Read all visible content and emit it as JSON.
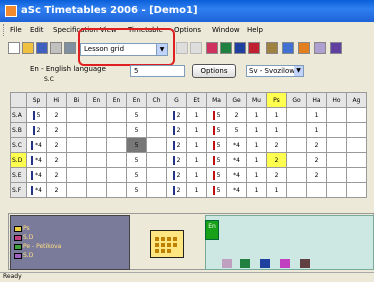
{
  "window": {
    "title": "aSc Timetables 2006 - [Demo1]"
  },
  "menu": [
    "File",
    "Edit",
    "Specification",
    "View",
    "Timetable",
    "Options",
    "Window",
    "Help"
  ],
  "toolbar": {
    "view_select": "Lesson grid"
  },
  "subbar": {
    "language": "En - English language",
    "class_caption": "S.C",
    "input_value": "5",
    "options_label": "Options",
    "view_select": "Sv - Svozilow"
  },
  "grid": {
    "headers": [
      "Sp",
      "Hi",
      "Bi",
      "En",
      "En",
      "En",
      "Ch",
      "G",
      "Et",
      "Ma",
      "Ge",
      "Mu",
      "Ps",
      "Go",
      "Ha",
      "Ho",
      "Ag"
    ],
    "highlight_header": "Ps",
    "rows": [
      {
        "label": "S.A",
        "cells": [
          "5",
          "2",
          "",
          "",
          "",
          "5",
          "",
          "2",
          "1",
          "5",
          "2",
          "1",
          "1",
          "",
          "1",
          "",
          ""
        ]
      },
      {
        "label": "S.B",
        "cells": [
          "2",
          "2",
          "",
          "",
          "",
          "5",
          "",
          "2",
          "1",
          "5",
          "5",
          "1",
          "1",
          "",
          "1",
          "",
          ""
        ]
      },
      {
        "label": "S.C",
        "cells": [
          "*4",
          "2",
          "",
          "",
          "",
          "5",
          "",
          "2",
          "1",
          "5",
          "*4",
          "1",
          "2",
          "",
          "2",
          "",
          ""
        ]
      },
      {
        "label": "S.D",
        "cells": [
          "*4",
          "2",
          "",
          "",
          "",
          "5",
          "",
          "2",
          "1",
          "5",
          "*4",
          "1",
          "2",
          "",
          "2",
          "",
          ""
        ]
      },
      {
        "label": "S.E",
        "cells": [
          "*4",
          "2",
          "",
          "",
          "",
          "5",
          "",
          "2",
          "1",
          "5",
          "*4",
          "1",
          "2",
          "",
          "2",
          "",
          ""
        ]
      },
      {
        "label": "S.F",
        "cells": [
          "*4",
          "2",
          "",
          "",
          "",
          "5",
          "",
          "2",
          "1",
          "5",
          "*4",
          "1",
          "1",
          "",
          "",
          "",
          ""
        ]
      }
    ]
  },
  "card": {
    "lines": [
      "Ps",
      "S.D",
      "Pe - Petikova",
      "S.D"
    ]
  },
  "panel": {
    "en_card": "En"
  },
  "status": "Ready"
}
